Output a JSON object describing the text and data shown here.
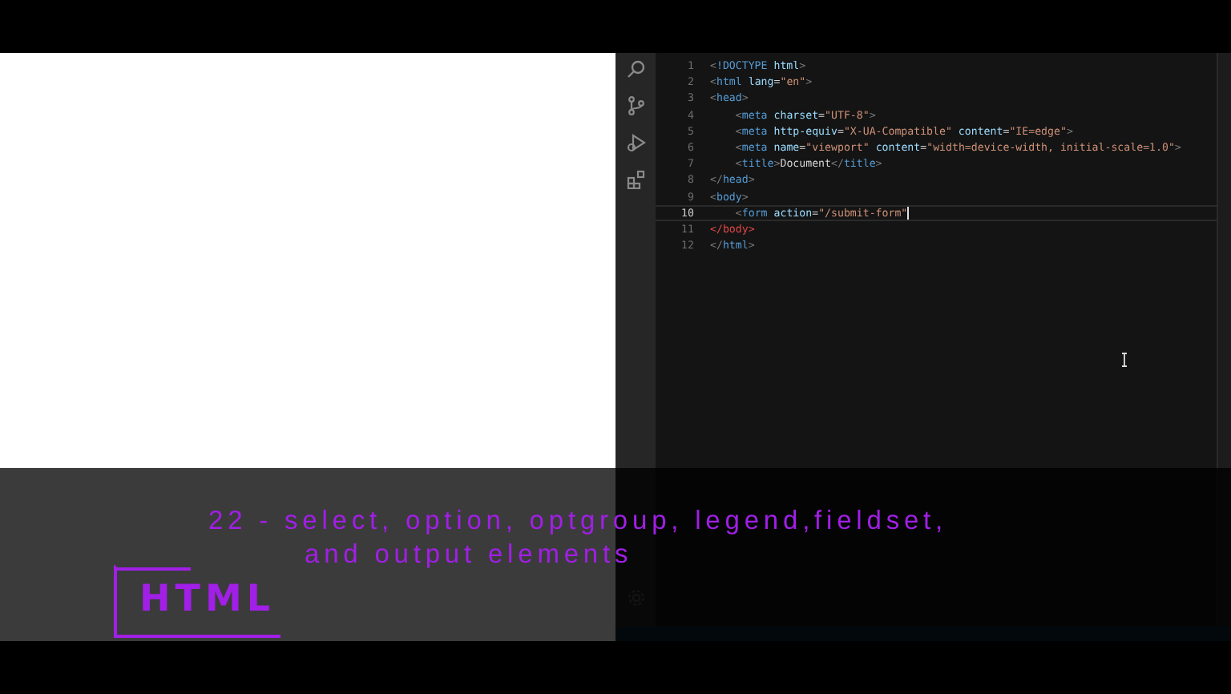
{
  "editor": {
    "lines": [
      {
        "number": "1",
        "code": "<!DOCTYPE html>",
        "active": false,
        "error": false
      },
      {
        "number": "2",
        "code": "<html lang=\"en\">",
        "active": false,
        "error": false
      },
      {
        "number": "3",
        "code": "<head>",
        "active": false,
        "error": false
      },
      {
        "number": "4",
        "code": "    <meta charset=\"UTF-8\">",
        "active": false,
        "error": false
      },
      {
        "number": "5",
        "code": "    <meta http-equiv=\"X-UA-Compatible\" content=\"IE=edge\">",
        "active": false,
        "error": false
      },
      {
        "number": "6",
        "code": "    <meta name=\"viewport\" content=\"width=device-width, initial-scale=1.0\">",
        "active": false,
        "error": false
      },
      {
        "number": "7",
        "code": "    <title>Document</title>",
        "active": false,
        "error": false
      },
      {
        "number": "8",
        "code": "</head>",
        "active": false,
        "error": false
      },
      {
        "number": "9",
        "code": "<body>",
        "active": false,
        "error": false
      },
      {
        "number": "10",
        "code": "    <form action=\"/submit-form\"",
        "active": true,
        "error": false
      },
      {
        "number": "11",
        "code": "</body>",
        "active": false,
        "error": true
      },
      {
        "number": "12",
        "code": "</html>",
        "active": false,
        "error": false
      }
    ]
  },
  "overlay": {
    "title": "22 - select, option, optgroup, legend,fieldset,\nand output elements",
    "logo": "HTML"
  }
}
